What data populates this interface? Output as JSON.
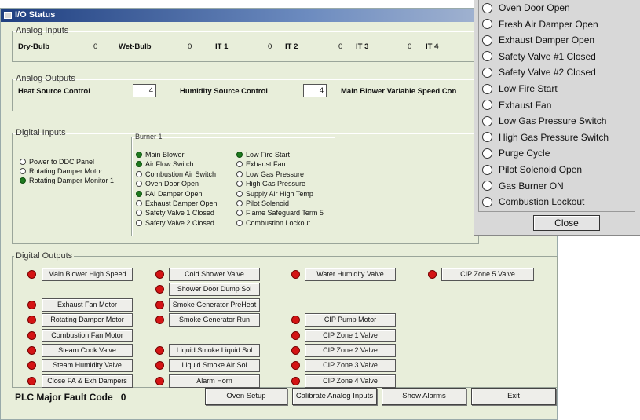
{
  "window": {
    "title": "I/O Status"
  },
  "analog_inputs": {
    "legend": "Analog Inputs",
    "items": [
      {
        "label": "Dry-Bulb",
        "value": "0"
      },
      {
        "label": "Wet-Bulb",
        "value": "0"
      },
      {
        "label": "IT 1",
        "value": "0"
      },
      {
        "label": "IT 2",
        "value": "0"
      },
      {
        "label": "IT 3",
        "value": "0"
      },
      {
        "label": "IT 4",
        "value": ""
      }
    ]
  },
  "analog_outputs": {
    "legend": "Analog Outputs",
    "heat_source_label": "Heat Source Control",
    "heat_source_value": "4",
    "humidity_source_label": "Humidity Source Control",
    "humidity_source_value": "4",
    "main_blower_label": "Main Blower Variable Speed Con"
  },
  "digital_inputs": {
    "legend": "Digital Inputs",
    "left": [
      {
        "label": "Power to DDC Panel",
        "on": false
      },
      {
        "label": "Rotating Damper Motor",
        "on": false
      },
      {
        "label": "Rotating Damper Monitor 1",
        "on": true
      }
    ],
    "burner": {
      "legend": "Burner 1",
      "col1": [
        {
          "label": "Main Blower",
          "on": true
        },
        {
          "label": "Air Flow Switch",
          "on": true
        },
        {
          "label": "Combustion Air Switch",
          "on": false
        },
        {
          "label": "Oven Door Open",
          "on": false
        },
        {
          "label": "FAI Damper Open",
          "on": true
        },
        {
          "label": "Exhaust Damper Open",
          "on": false
        },
        {
          "label": "Safety Valve 1 Closed",
          "on": false
        },
        {
          "label": "Safety Valve 2 Closed",
          "on": false
        }
      ],
      "col2": [
        {
          "label": "Low Fire Start",
          "on": true
        },
        {
          "label": "Exhaust Fan",
          "on": false
        },
        {
          "label": "Low Gas Pressure",
          "on": false
        },
        {
          "label": "High Gas Pressure",
          "on": false
        },
        {
          "label": "Supply Air High Temp",
          "on": false
        },
        {
          "label": "Pilot Solenoid",
          "on": false
        },
        {
          "label": "Flame Safeguard Term 5",
          "on": false
        },
        {
          "label": "Combustion Lockout",
          "on": false
        }
      ]
    }
  },
  "digital_outputs": {
    "legend": "Digital Outputs",
    "col1": [
      "Main Blower High Speed",
      "",
      "Exhaust Fan Motor",
      "Rotating Damper Motor",
      "Combustion Fan Motor",
      "Steam Cook Valve",
      "Steam Humidity Valve",
      "Close FA & Exh Dampers"
    ],
    "col2": [
      "Cold Shower Valve",
      "Shower Door Dump Sol",
      "Smoke Generator PreHeat",
      "Smoke Generator Run",
      "",
      "Liquid Smoke Liquid Sol",
      "Liquid Smoke Air Sol",
      "Alarm Horn"
    ],
    "col3": [
      "Water Humidity Valve",
      "",
      "",
      "CIP Pump Motor",
      "CIP Zone 1 Valve",
      "CIP Zone 2 Valve",
      "CIP Zone 3 Valve",
      "CIP Zone 4 Valve"
    ],
    "col4": [
      "CIP Zone 5 Valve"
    ]
  },
  "fault": {
    "label": "PLC Major Fault Code",
    "value": "0"
  },
  "bottom_buttons": [
    "Oven Setup",
    "Calibrate Analog Inputs",
    "Show Alarms",
    "Exit"
  ],
  "popup": {
    "items": [
      {
        "label": "Oven Door Open",
        "on": false
      },
      {
        "label": "Fresh Air Damper Open",
        "on": false
      },
      {
        "label": "Exhaust Damper Open",
        "on": false
      },
      {
        "label": "Safety Valve #1 Closed",
        "on": false
      },
      {
        "label": "Safety Valve #2 Closed",
        "on": false
      },
      {
        "label": "Low Fire Start",
        "on": false
      },
      {
        "label": "Exhaust Fan",
        "on": false
      },
      {
        "label": "Low Gas Pressure Switch",
        "on": false
      },
      {
        "label": "High Gas Pressure Switch",
        "on": false
      },
      {
        "label": "Purge Cycle",
        "on": false
      },
      {
        "label": "Pilot Solenoid Open",
        "on": false
      },
      {
        "label": "Gas Burner ON",
        "on": false
      },
      {
        "label": "Combustion Lockout",
        "on": false
      }
    ],
    "close_label": "Close"
  }
}
